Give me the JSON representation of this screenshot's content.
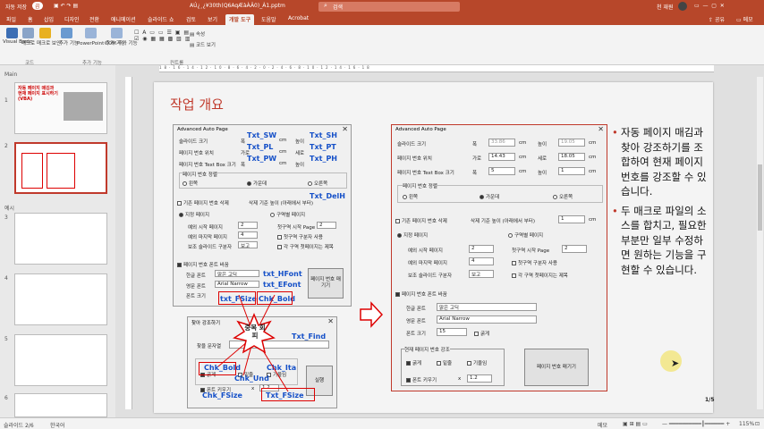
{
  "titlebar": {
    "autosave": "자동 저장",
    "toggle": "끔",
    "filename": "AÚ¿¸¿¥30th(Q6AqÆàÀÂ0)_À1.pptm",
    "search_placeholder": "검색",
    "user": "천 재원",
    "share": "공유",
    "comment": "메모"
  },
  "tabs": [
    "파일",
    "홈",
    "삽입",
    "디자인",
    "전환",
    "애니메이션",
    "슬라이드 쇼",
    "검토",
    "보기",
    "개발 도구",
    "도움말",
    "Acrobat"
  ],
  "active_tab": "개발 도구",
  "ribbon": {
    "vb": "Visual Basic",
    "macro": "매크로",
    "macro_security": "매크로 보안",
    "addin": "추가 기능",
    "ppt_addin": "PowerPoint 추가 기능",
    "com_addin": "COM 추가 기능",
    "properties": "속성",
    "view_code": "코드 보기",
    "groups": {
      "code": "코드",
      "addins": "추가 기능",
      "controls": "컨트롤"
    }
  },
  "thumbs": {
    "section_main": "Main",
    "section_ex": "예시",
    "slide1_text": "자동 페이지 매김과 현재 페이지 표시하기 (VBA)",
    "numbers": [
      "1",
      "2",
      "3",
      "4",
      "5",
      "6"
    ]
  },
  "ruler": "18·16·14·12·10·8·6·4·2·0·2·4·6·8·10·12·14·16·18",
  "slide": {
    "title": "작업 개요",
    "page": "1/5",
    "bullets": [
      "자동 페이지 매김과 찾아 강조하기를 조합하여 현재 페이지 번호를 강조할 수 있습니다.",
      "두 매크로 파일의 소스를 합치고, 필요한 부분만 일부 수정하면 원하는 기능을 구현할 수 있습니다."
    ],
    "star": "중복 회피"
  },
  "dlgA": {
    "title": "Advanced Auto Page",
    "slide_size": "슬라이드 크기",
    "width": "폭",
    "height": "높이",
    "unit": "cm",
    "page_pos": "페이지 번호 위치",
    "horiz": "가로",
    "vert": "세로",
    "textbox_size": "페이지 번호 Text Box 크기",
    "align": "페이지 번호 정렬",
    "left": "왼쪽",
    "center": "가운데",
    "right": "오른쪽",
    "del_existing": "기존 페이지 번호 삭제",
    "del_basis": "삭제 기준 높이 (아래에서 부터)",
    "specified": "지정 페이지",
    "section": "구역별 페이지",
    "start_page": "예외 시작 페이지",
    "end_page": "예외 마지막 페이지",
    "sup_slide": "보조 슬라이드 구분자",
    "start_val": "2",
    "end_val": "4",
    "sup_val": "보고",
    "first_section": "첫구역 시작 Page",
    "first_val": "2",
    "use_first": "첫구역 구분자 사용",
    "each_first": "각 구역 첫페이지는 제목",
    "font_change": "페이지 번호 폰트 바꿈",
    "kor_font": "한글 폰트",
    "kor_val": "맑은 고딕",
    "eng_font": "영문 폰트",
    "eng_val": "Arial Narrow",
    "font_size": "폰트 크기",
    "size_val": "15",
    "bold": "굵게",
    "run": "페이지 번호 매기기"
  },
  "dlgB": {
    "title": "Advanced Auto Page",
    "slide_w": "33.86",
    "slide_h": "19.05",
    "pos_x": "14.43",
    "pos_y": "18.05",
    "box_w": "5",
    "box_h": "1",
    "del_h": "1",
    "current_highlight": "현재 페이지 번호 강조",
    "bold": "굵게",
    "italic": "밑줄",
    "tilt": "기울임",
    "font_up": "폰트 키우기",
    "mult": "x",
    "up_val": "1.2"
  },
  "find": {
    "title": "찾아 강조하기",
    "find_word": "찾을 문자열",
    "bold": "굵게",
    "underline": "밑줄",
    "italic": "기울임",
    "font_up": "폰트 키우기",
    "mult": "x",
    "up_val": "1.2",
    "run": "실행"
  },
  "vars": {
    "sw": "Txt_SW",
    "sh": "Txt_SH",
    "pl": "Txt_PL",
    "pt": "Txt_PT",
    "pw": "Txt_PW",
    "ph": "Txt_PH",
    "delh": "Txt_DelH",
    "hfont": "txt_HFont",
    "efont": "txt_EFont",
    "fsize": "txt_FSize",
    "chkbold": "Chk_Bold",
    "find": "Txt_Find",
    "chkbold2": "Chk_Bold",
    "chkund": "Chk_Und",
    "chkita": "Chk_Ita",
    "chkfsize": "Chk_FSize",
    "txtfsize": "Txt_FSize"
  },
  "status": {
    "slide": "슬라이드 2/6",
    "lang": "한국어",
    "notes": "메모",
    "zoom": "115%"
  },
  "colors": {
    "accent": "#b7472a",
    "red": "#c0392b",
    "blue": "#1550c8"
  }
}
